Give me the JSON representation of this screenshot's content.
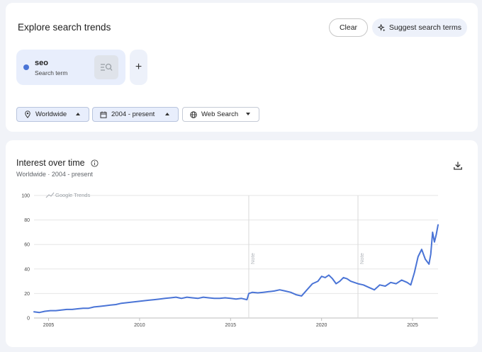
{
  "explore": {
    "title": "Explore search trends",
    "clear_label": "Clear",
    "suggest_label": "Suggest search terms",
    "term": {
      "name": "seo",
      "subtitle": "Search term",
      "color": "#4a74d6"
    },
    "add_label": "+",
    "filters": {
      "location": "Worldwide",
      "time": "2004 - present",
      "type": "Web Search"
    }
  },
  "interest": {
    "title": "Interest over time",
    "subtitle": "Worldwide · 2004 - present",
    "watermark": "Google Trends"
  },
  "chart_data": {
    "type": "line",
    "title": "Interest over time",
    "xlabel": "",
    "ylabel": "",
    "xlim": [
      2004.2,
      2026.4
    ],
    "ylim": [
      0,
      100
    ],
    "y_ticks": [
      0,
      20,
      40,
      60,
      80,
      100
    ],
    "x_ticks": [
      "2005",
      "2010",
      "2015",
      "2020",
      "2025"
    ],
    "grid": true,
    "annotations": [
      {
        "label": "Note",
        "x": 2016.0
      },
      {
        "label": "Note",
        "x": 2022.0
      }
    ],
    "series": [
      {
        "color": "#4a74d6",
        "points": [
          [
            2004.2,
            5
          ],
          [
            2004.5,
            4.5
          ],
          [
            2004.8,
            5.5
          ],
          [
            2005.1,
            6
          ],
          [
            2005.4,
            6
          ],
          [
            2005.7,
            6.5
          ],
          [
            2006.0,
            7
          ],
          [
            2006.3,
            7
          ],
          [
            2006.6,
            7.5
          ],
          [
            2006.9,
            8
          ],
          [
            2007.2,
            8
          ],
          [
            2007.5,
            9
          ],
          [
            2007.8,
            9.5
          ],
          [
            2008.1,
            10
          ],
          [
            2008.4,
            10.5
          ],
          [
            2008.7,
            11
          ],
          [
            2009.0,
            12
          ],
          [
            2009.3,
            12.5
          ],
          [
            2009.6,
            13
          ],
          [
            2009.9,
            13.5
          ],
          [
            2010.2,
            14
          ],
          [
            2010.5,
            14.5
          ],
          [
            2010.8,
            15
          ],
          [
            2011.1,
            15.5
          ],
          [
            2011.4,
            16
          ],
          [
            2011.7,
            16.5
          ],
          [
            2012.0,
            17
          ],
          [
            2012.3,
            16
          ],
          [
            2012.6,
            17
          ],
          [
            2012.9,
            16.5
          ],
          [
            2013.2,
            16
          ],
          [
            2013.5,
            17
          ],
          [
            2013.8,
            16.5
          ],
          [
            2014.1,
            16
          ],
          [
            2014.4,
            16
          ],
          [
            2014.7,
            16.5
          ],
          [
            2015.0,
            16
          ],
          [
            2015.3,
            15.5
          ],
          [
            2015.6,
            16
          ],
          [
            2015.9,
            15
          ],
          [
            2016.0,
            20
          ],
          [
            2016.2,
            21
          ],
          [
            2016.5,
            20.5
          ],
          [
            2016.8,
            21
          ],
          [
            2017.1,
            21.5
          ],
          [
            2017.4,
            22
          ],
          [
            2017.7,
            23
          ],
          [
            2018.0,
            22
          ],
          [
            2018.3,
            21
          ],
          [
            2018.6,
            19
          ],
          [
            2018.9,
            18
          ],
          [
            2019.2,
            23
          ],
          [
            2019.5,
            28
          ],
          [
            2019.8,
            30
          ],
          [
            2020.0,
            34
          ],
          [
            2020.2,
            33
          ],
          [
            2020.4,
            35
          ],
          [
            2020.6,
            32
          ],
          [
            2020.8,
            28
          ],
          [
            2021.0,
            30
          ],
          [
            2021.2,
            33
          ],
          [
            2021.4,
            32
          ],
          [
            2021.6,
            30
          ],
          [
            2021.8,
            29
          ],
          [
            2022.0,
            28
          ],
          [
            2022.3,
            27
          ],
          [
            2022.6,
            25
          ],
          [
            2022.9,
            23
          ],
          [
            2023.2,
            27
          ],
          [
            2023.5,
            26
          ],
          [
            2023.8,
            29
          ],
          [
            2024.1,
            28
          ],
          [
            2024.4,
            31
          ],
          [
            2024.7,
            29
          ],
          [
            2024.9,
            27
          ],
          [
            2025.1,
            37
          ],
          [
            2025.3,
            50
          ],
          [
            2025.5,
            56
          ],
          [
            2025.7,
            48
          ],
          [
            2025.9,
            44
          ],
          [
            2026.0,
            52
          ],
          [
            2026.1,
            70
          ],
          [
            2026.2,
            62
          ],
          [
            2026.3,
            68
          ],
          [
            2026.4,
            76
          ]
        ]
      }
    ]
  }
}
